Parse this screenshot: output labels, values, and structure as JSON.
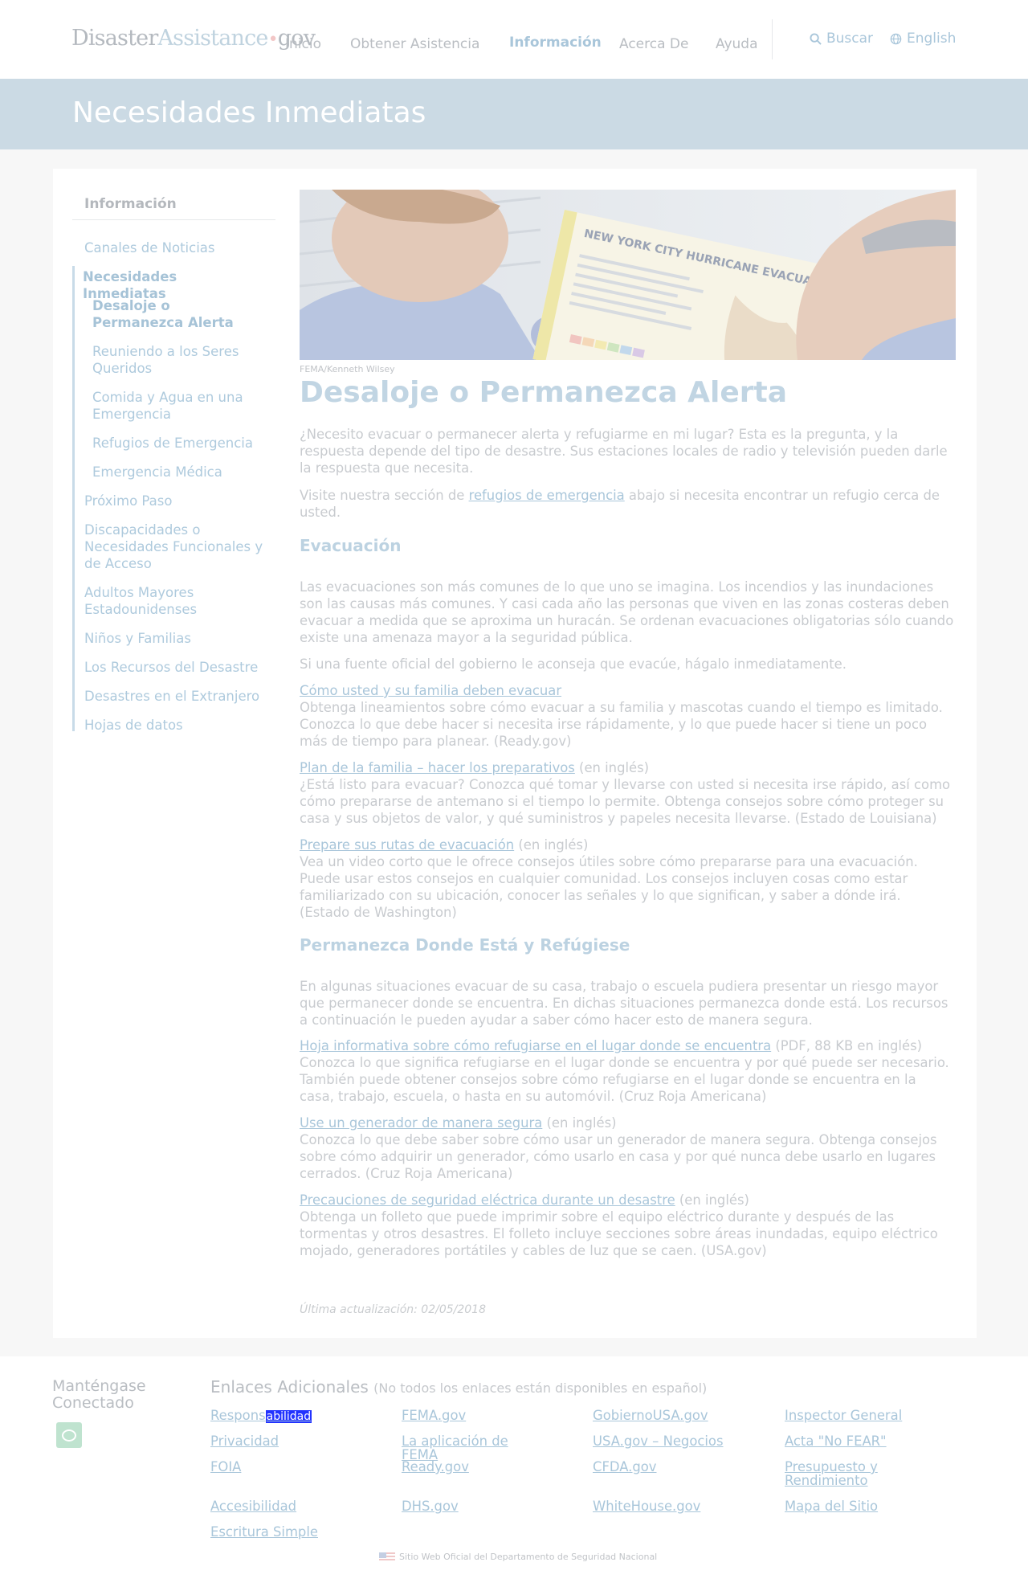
{
  "header": {
    "logo_part1": "Disaster",
    "logo_part2": "Assistance",
    "logo_dot": "•",
    "logo_part3": "gov",
    "nav": [
      "Inicio",
      "Obtener Asistencia",
      "Información",
      "Acerca De",
      "Ayuda"
    ],
    "search_label": "Buscar",
    "language_label": "English"
  },
  "banner": {
    "title": "Necesidades Inmediatas"
  },
  "sidebar": {
    "title": "Información",
    "items": [
      "Canales de Noticias",
      "Necesidades Inmediatas",
      "Desaloje o Permanezca Alerta",
      "Reuniendo a los Seres Queridos",
      "Comida y Agua en una Emergencia",
      "Refugios de Emergencia",
      "Emergencia Médica",
      "Próximo Paso",
      "Discapacidades o Necesidades Funcionales y de Acceso",
      "Adultos Mayores Estadounidenses",
      "Niños y Familias",
      "Los Recursos del Desastre",
      "Desastres en el Extranjero",
      "Hojas de datos"
    ]
  },
  "hero": {
    "caption": "FEMA/Kenneth Wilsey",
    "map_title": "NEW YORK CITY HURRICANE EVACUATION ZONES"
  },
  "article": {
    "title": "Desaloje o Permanezca Alerta",
    "intro": "¿Necesito evacuar o permanecer alerta y refugiarme en mi lugar? Esta es la pregunta, y la respuesta depende del tipo de desastre. Sus estaciones locales de radio y televisión pueden darle la respuesta que necesita.",
    "shelters_pre": "Visite nuestra sección de ",
    "shelters_link": "refugios de emergencia",
    "shelters_post": " abajo si necesita encontrar un refugio cerca de usted.",
    "evac_heading": "Evacuación",
    "evac_p1": "Las evacuaciones son más comunes de lo que uno se imagina. Los incendios y las inundaciones son las causas más comunes. Y casi cada año las personas que viven en las zonas costeras deben evacuar a medida que se aproxima un huracán. Se ordenan evacuaciones obligatorias sólo cuando existe una amenaza mayor a la seguridad pública.",
    "evac_p2": "Si una fuente oficial del gobierno le aconseja que evacúe, hágalo inmediatamente.",
    "res1_link": "Cómo usted y su familia deben evacuar",
    "res1_tag": "",
    "res1_desc": "Obtenga lineamientos sobre cómo evacuar a su familia y mascotas cuando el tiempo es limitado. Conozca lo que debe hacer si necesita irse rápidamente, y lo que puede hacer si tiene un poco más de tiempo para planear. (Ready.gov)",
    "res2_link": "Plan de la familia – hacer los preparativos",
    "res2_tag": " (en inglés)",
    "res2_desc": "¿Está listo para evacuar? Conozca qué tomar y llevarse con usted si necesita irse rápido, así como cómo prepararse de antemano si el tiempo lo permite. Obtenga consejos sobre cómo proteger su casa y sus objetos de valor, y qué suministros y papeles necesita llevarse. (Estado de Louisiana)",
    "res3_link": "Prepare sus rutas de evacuación",
    "res3_tag": " (en inglés)",
    "res3_desc": "Vea un video corto que le ofrece consejos útiles sobre cómo prepararse para una evacuación. Puede usar estos consejos en cualquier comunidad. Los consejos incluyen cosas como estar familiarizado con su ubicación, conocer las señales y lo que significan, y saber a dónde irá. (Estado de Washington)",
    "stay_heading": "Permanezca Donde Está y Refúgiese",
    "stay_p1": "En algunas situaciones evacuar de su casa, trabajo o escuela pudiera presentar un riesgo mayor que permanecer donde se encuentra. En dichas situaciones permanezca donde está. Los recursos a continuación le pueden ayudar a saber cómo hacer esto de manera segura.",
    "res4_link": "Hoja informativa sobre cómo refugiarse en el lugar donde se encuentra",
    "res4_tag": " (PDF, 88 KB en inglés)",
    "res4_desc": "Conozca lo que significa refugiarse en el lugar donde se encuentra y por qué puede ser necesario. También puede obtener consejos sobre cómo refugiarse en el lugar donde se encuentra en la casa, trabajo, escuela, o hasta en su automóvil. (Cruz Roja Americana)",
    "res5_link": "Use un generador de manera segura",
    "res5_tag": " (en inglés)",
    "res5_desc": "Conozca lo que debe saber sobre cómo usar un generador de manera segura. Obtenga consejos sobre cómo adquirir un generador, cómo usarlo en casa y por qué nunca debe usarlo en lugares cerrados. (Cruz Roja Americana)",
    "res6_link": "Precauciones de seguridad eléctrica durante un desastre",
    "res6_tag": " (en inglés)",
    "res6_desc": "Obtenga un folleto que puede imprimir sobre el equipo eléctrico durante y después de las tormentas y otros desastres. El folleto incluye secciones sobre áreas inundadas, equipo eléctrico mojado, generadores portátiles y cables de luz que se caen. (USA.gov)",
    "updated": "Última actualización: 02/05/2018"
  },
  "footer": {
    "connect": "Manténgase Conectado",
    "links_heading": "Enlaces Adicionales",
    "links_note": "(No todos los enlaces están disponibles en español)",
    "col1": [
      "Respons",
      "Privacidad",
      "FOIA",
      "Accesibilidad",
      "Escritura Simple"
    ],
    "col1_glitch": "abilidad",
    "col2": [
      "FEMA.gov",
      "La aplicación de FEMA",
      "Ready.gov",
      "DHS.gov"
    ],
    "col3": [
      "GobiernoUSA.gov",
      "USA.gov – Negocios",
      "CFDA.gov",
      "WhiteHouse.gov"
    ],
    "col4": [
      "Inspector General",
      "Acta \"No FEAR\"",
      "Presupuesto y Rendimiento",
      "Mapa del Sitio"
    ],
    "official": "Sitio Web Oficial del Departamento de Seguridad Nacional"
  }
}
